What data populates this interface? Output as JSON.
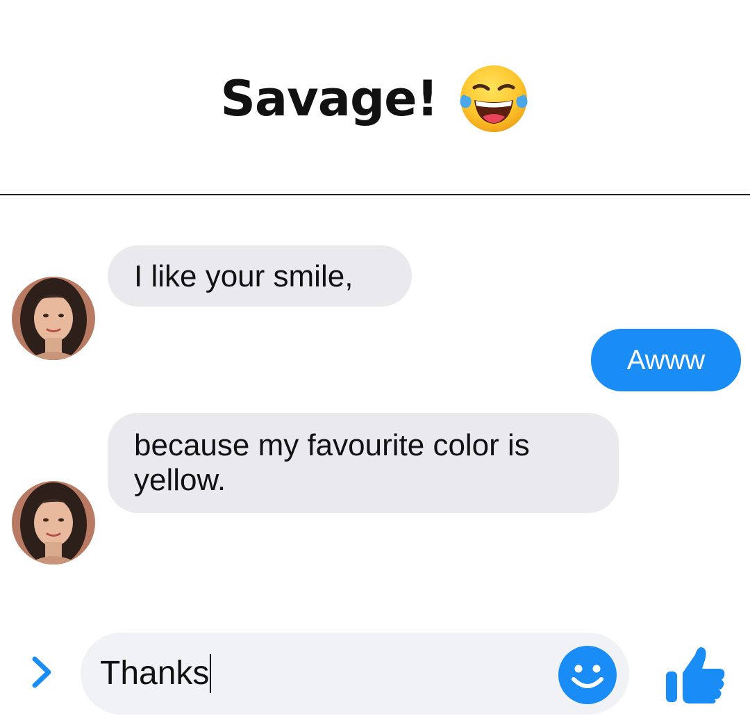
{
  "header": {
    "title": "Savage!",
    "emoji": "tears-of-joy-emoji"
  },
  "messages": [
    {
      "direction": "incoming",
      "text": "I like your smile,"
    },
    {
      "direction": "outgoing",
      "text": "Awww"
    },
    {
      "direction": "incoming",
      "text": "because my favourite color is yellow."
    }
  ],
  "composer": {
    "value": "Thanks",
    "expand_icon": "chevron-right-icon",
    "emoji_icon": "smiley-icon",
    "send_icon": "thumbs-up-icon"
  },
  "colors": {
    "accent": "#1a8cf5",
    "incoming_bubble": "#e9e9ee",
    "input_background": "#f0f2f5",
    "divider": "#222222"
  }
}
